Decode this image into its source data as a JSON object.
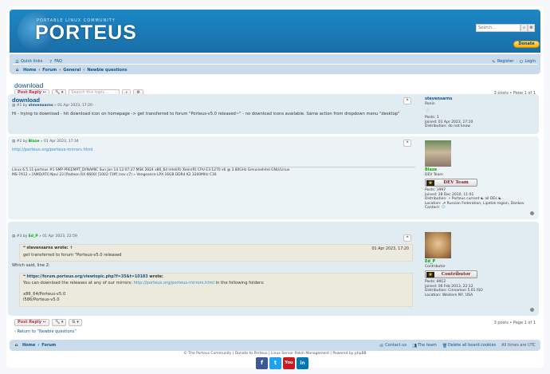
{
  "header": {
    "site_tagline": "PORTABLE LINUX COMMUNITY",
    "site_name": "PORTEUS",
    "search_placeholder": "Search...",
    "search_icon": "search-icon",
    "advanced_icon": "gear-icon",
    "donate_label": "Donate"
  },
  "nav": {
    "quick_links": "Quick links",
    "faq": "FAQ",
    "register": "Register",
    "login": "Login",
    "breadcrumbs": [
      "Home",
      "Forum",
      "General",
      "Newbie questions"
    ],
    "sep": "‹"
  },
  "topic": {
    "title": "download",
    "post_reply": "Post Reply",
    "search_placeholder": "Search this topic...",
    "pagination": "3 posts • Page 1 of 1"
  },
  "posts": [
    {
      "title": "download",
      "meta_num": "#1 by",
      "author": "stevensarns",
      "date": "» 01 Apr 2023, 17:20",
      "body": "Hi - trying to download - hit download icon on homepage -> get transferred to forum \"Porteus-v5.0 released~\" - no download icons available. Same action from dropdown menu \"desktop\"",
      "profile": {
        "name": "stevensarns",
        "rank": "Ronin",
        "posts": "Posts: 1",
        "joined": "Joined: 01 Apr 2023, 17:10",
        "distribution": "Distribution: do not know"
      }
    },
    {
      "meta_num": "#2 by",
      "author": "Blaze",
      "date": "» 01 Apr 2023, 17:34",
      "link": "http://porteus.org/porteus-mirrors.html",
      "sig_line1": "Linux 6.5.11-porteus #1 SMP PREEMPT_DYNAMIC Sun Jan 14 12:07:37 MSK 2024 x86_64 Intel(R) Xeon(R) CPU E3-1270 v6 @ 3.80GHz GenuineIntel GNU/Linux",
      "sig_line2": "MS-7A12 » [AMD/ATI] Navi 23 [Radeon RX 6600] [1002:73ff] (rev c7) » Vengeance LPX 16GB DDR4 K2 3200MHz C16",
      "profile": {
        "name": "Blaze",
        "rank": "DEV Team",
        "rank_badge": "DEV Team",
        "posts": "Posts: 3997",
        "joined": "Joined: 28 Dec 2010, 11:01",
        "distribution": "Distribution: ⚡ Porteus current ☯ all DEs ☯",
        "location": "Location: ☭ Russian Federation, Lipetsk region, Dankov",
        "contact": "Contact:"
      }
    },
    {
      "meta_num": "#3 by",
      "author": "Ed_P",
      "date": "» 01 Apr 2023, 22:59",
      "quote1_author": "stevensarns wrote: ↑",
      "quote1_date": "01 Apr 2023, 17:20",
      "quote1_text": "get transferred to forum \"Porteus-v5.0 released",
      "middle_text": "Which said, line 2:",
      "quote2_link": "https://forum.porteus.org/viewtopic.php?f=35&t=10183",
      "quote2_wrote": "wrote:",
      "quote2_text_a": "You can download the releases at any of our mirrors:",
      "quote2_link2": "http://porteus.org/porteus-mirrors.html",
      "quote2_text_b": "in the following folders:",
      "folder1": "x86_64/Porteus-v5.0",
      "folder2": "i586/Porteus-v5.0",
      "profile": {
        "name": "Ed_P",
        "rank": "Contributor",
        "rank_badge": "Contributor",
        "posts": "Posts: 8912",
        "joined": "Joined: 06 Feb 2013, 22:12",
        "distribution": "Distribution: Cinnamon 5.01 ISO",
        "location": "Location: Western NY, USA"
      }
    }
  ],
  "return_link": "Return to “Newbie questions”",
  "footer": {
    "home": "Home",
    "forum": "Forum",
    "contact": "Contact us",
    "team": "The team",
    "delete_cookies": "Delete all board cookies",
    "timezone": "All times are UTC",
    "copyright": "© The Porteus Community | Donate to Porteus | Linux Server Patch Management | Powered by phpBB",
    "social": [
      "f",
      "t",
      "You",
      "in"
    ]
  },
  "colors": {
    "header": "#1b88c6",
    "navbar": "#cadceb",
    "link": "#105289",
    "reply": "#bc2a4d"
  }
}
